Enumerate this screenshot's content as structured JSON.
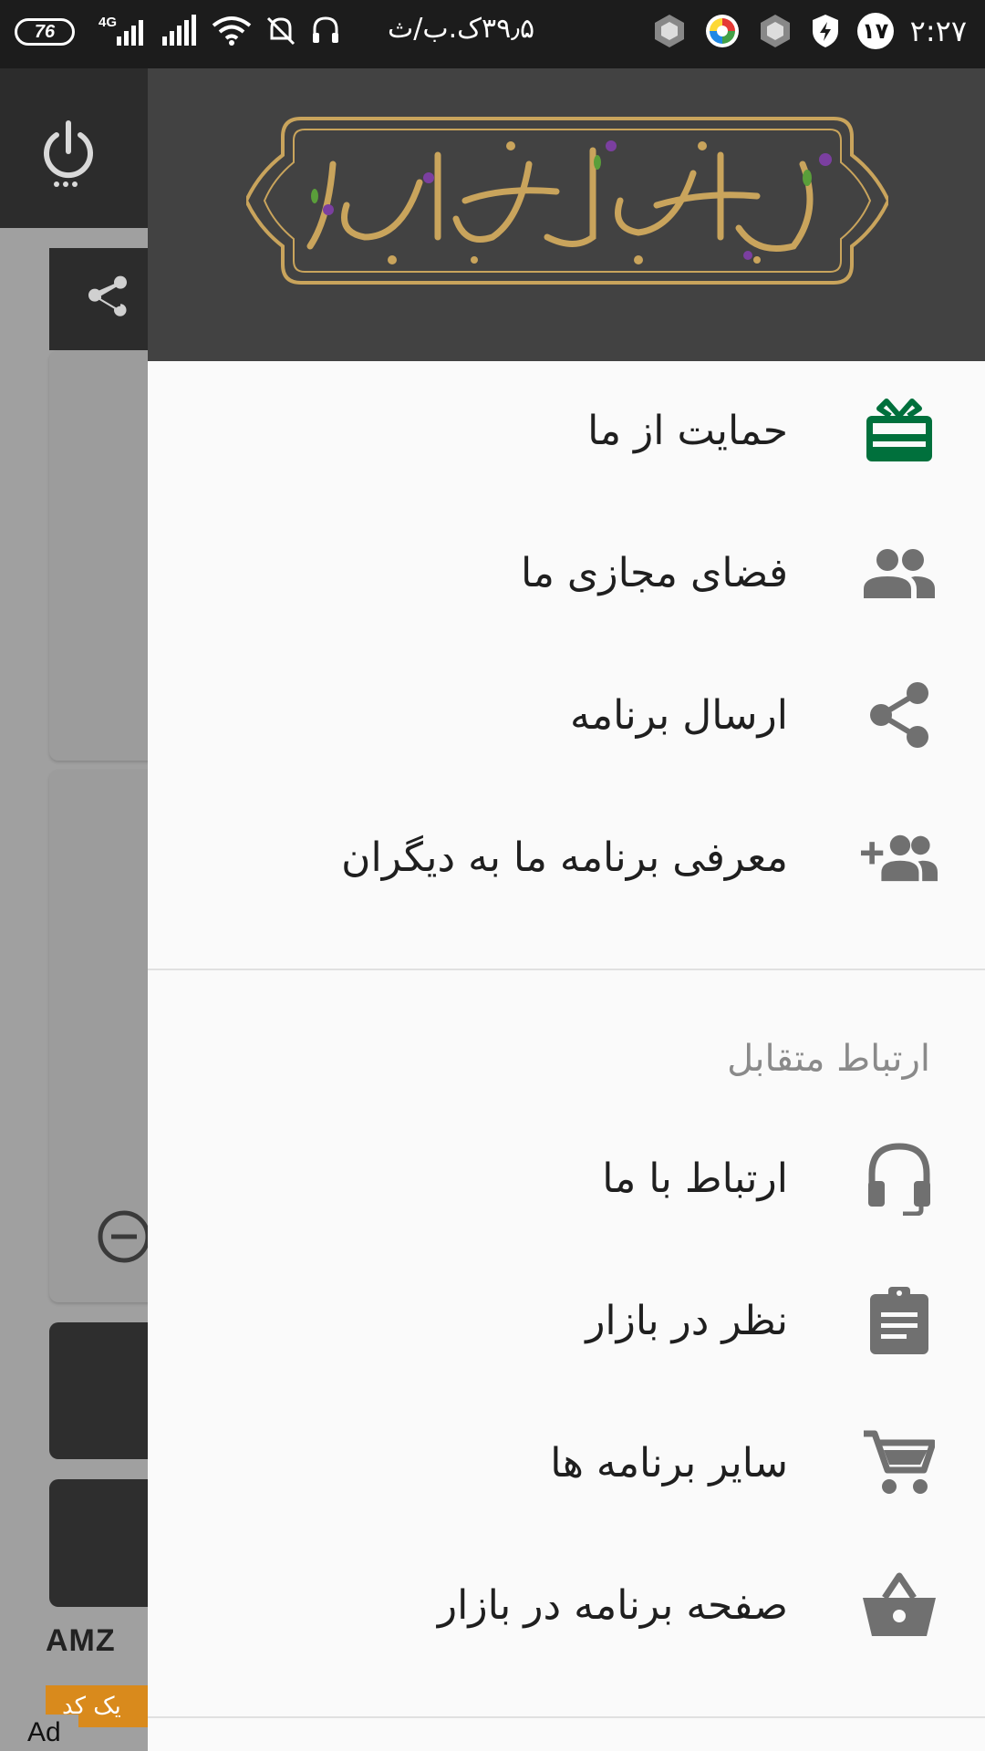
{
  "status_bar": {
    "battery": "76",
    "network_type": "4G",
    "notification_text": "۳۹٫۵ک.ب/ث",
    "badge": "۱۷",
    "time": "۲:۲۷"
  },
  "background_app": {
    "ad_logo": "AMZ",
    "ad_button": "یک کد",
    "ad_tag": "Ad"
  },
  "drawer": {
    "header_calligraphy": "برآیه های کوثر ما گریه می کنیم",
    "items": [
      {
        "label": "حمایت از ما",
        "icon": "gift-card-icon",
        "color": "#00703c"
      },
      {
        "label": "فضای مجازی ما",
        "icon": "people-icon",
        "color": "#707070"
      },
      {
        "label": "ارسال برنامه",
        "icon": "share-icon",
        "color": "#707070"
      },
      {
        "label": "معرفی برنامه ما به دیگران",
        "icon": "add-people-icon",
        "color": "#707070"
      }
    ],
    "section_title": "ارتباط متقابل",
    "section_items": [
      {
        "label": "ارتباط با ما",
        "icon": "headset-icon"
      },
      {
        "label": "نظر در بازار",
        "icon": "clipboard-icon"
      },
      {
        "label": "سایر برنامه ها",
        "icon": "cart-icon"
      },
      {
        "label": "صفحه برنامه در بازار",
        "icon": "basket-icon"
      }
    ]
  },
  "colors": {
    "drawer_bg": "#fafafa",
    "header_bg": "#424242",
    "gold": "#c9a45c",
    "accent_green": "#00703c",
    "icon_gray": "#707070"
  }
}
